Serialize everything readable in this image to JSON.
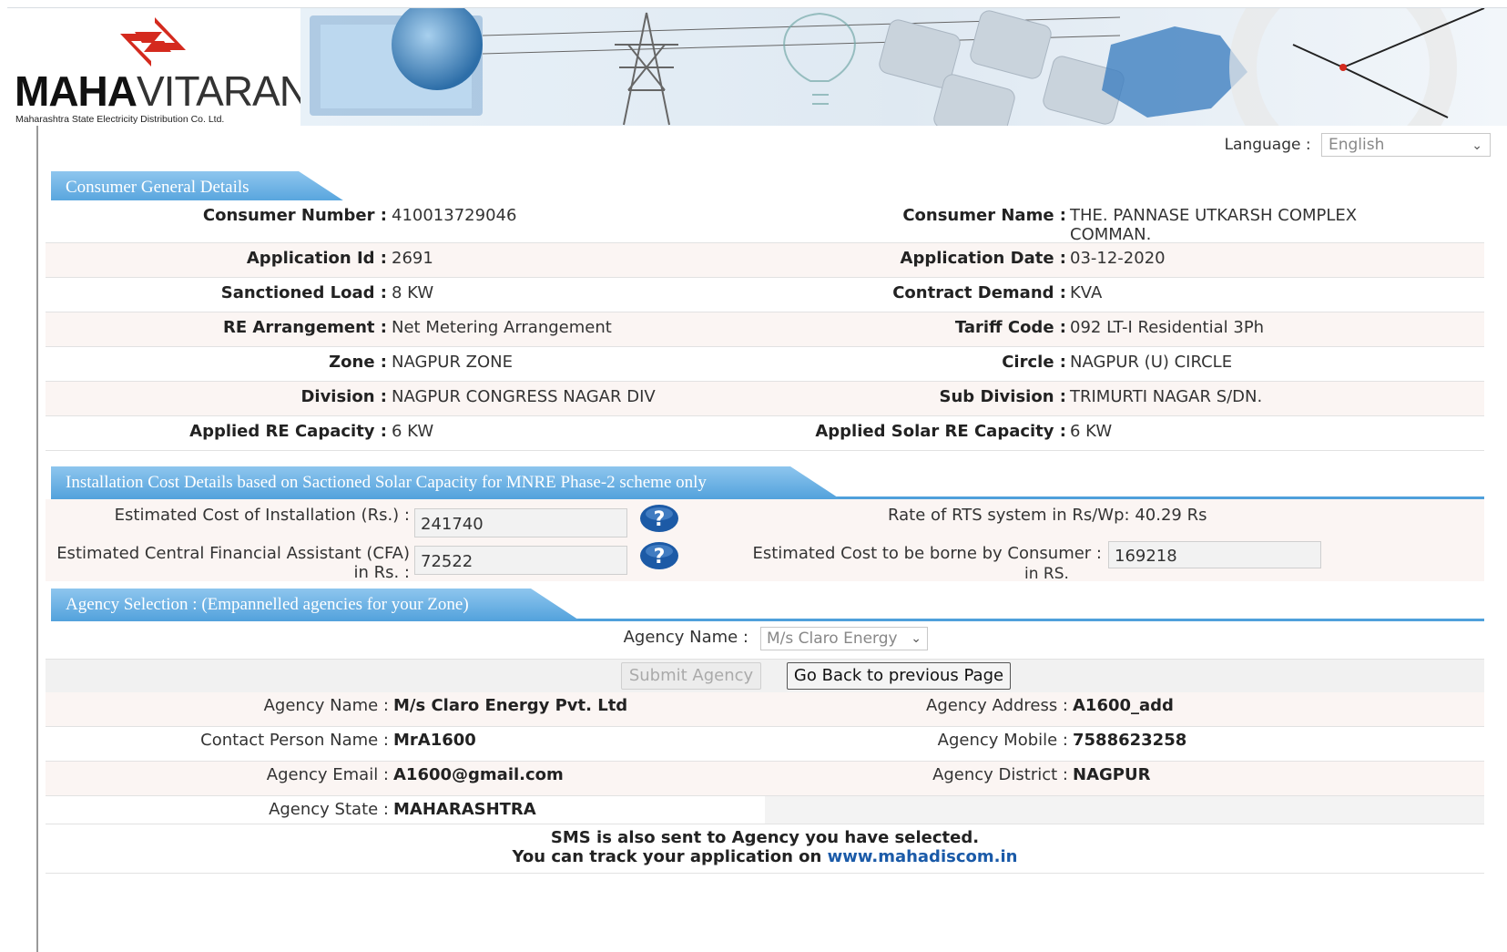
{
  "header": {
    "logo_bold": "MAHA",
    "logo_light": "VITARAN",
    "logo_subtitle": "Maharashtra State Electricity Distribution Co. Ltd."
  },
  "language": {
    "label": "Language :",
    "selected": "English"
  },
  "consumer_section": {
    "title": "Consumer General Details",
    "rows": [
      {
        "l_label": "Consumer Number :",
        "l_value": "410013729046",
        "r_label": "Consumer Name :",
        "r_value": "THE. PANNASE UTKARSH COMPLEX COMMAN."
      },
      {
        "l_label": "Application Id :",
        "l_value": "2691",
        "r_label": "Application Date :",
        "r_value": "03-12-2020"
      },
      {
        "l_label": "Sanctioned Load :",
        "l_value": "8 KW",
        "r_label": "Contract Demand :",
        "r_value": "KVA"
      },
      {
        "l_label": "RE Arrangement :",
        "l_value": "Net Metering Arrangement",
        "r_label": "Tariff Code :",
        "r_value": "092 LT-I Residential 3Ph"
      },
      {
        "l_label": "Zone :",
        "l_value": "NAGPUR ZONE",
        "r_label": "Circle :",
        "r_value": "NAGPUR (U) CIRCLE"
      },
      {
        "l_label": "Division :",
        "l_value": "NAGPUR CONGRESS NAGAR DIV",
        "r_label": "Sub Division :",
        "r_value": "TRIMURTI NAGAR S/DN."
      },
      {
        "l_label": "Applied RE Capacity :",
        "l_value": "6 KW",
        "r_label": "Applied Solar RE Capacity :",
        "r_value": "6 KW"
      }
    ]
  },
  "cost_section": {
    "title": "Installation Cost Details based on Sactioned Solar Capacity for MNRE Phase-2 scheme only",
    "estimated_cost_label": "Estimated Cost of Installation (Rs.) :",
    "estimated_cost_value": "241740",
    "rate_label": "Rate of RTS system in Rs/Wp:",
    "rate_value": "40.29 Rs",
    "cfa_label_line1": "Estimated Central Financial Assistant (CFA)",
    "cfa_label_line2": "in Rs. :",
    "cfa_value": "72522",
    "consumer_cost_label": "Estimated Cost to be borne by Consumer :",
    "consumer_cost_value": "169218",
    "consumer_cost_suffix": "in RS."
  },
  "agency_section": {
    "title": "Agency Selection : (Empannelled agencies for your Zone)",
    "agency_name_label": "Agency Name :",
    "agency_selected": "M/s Claro Energy",
    "submit_label": "Submit Agency",
    "back_label": "Go Back to previous Page",
    "details": [
      {
        "l_label": "Agency Name :",
        "l_value": "M/s Claro Energy Pvt. Ltd",
        "r_label": "Agency Address :",
        "r_value": "A1600_add"
      },
      {
        "l_label": "Contact Person Name :",
        "l_value": "MrA1600",
        "r_label": "Agency Mobile :",
        "r_value": "7588623258"
      },
      {
        "l_label": "Agency Email :",
        "l_value": "A1600@gmail.com",
        "r_label": "Agency District :",
        "r_value": "NAGPUR"
      },
      {
        "l_label": "Agency State :",
        "l_value": "MAHARASHTRA"
      }
    ],
    "sms_line1": "SMS is also sent to Agency you have selected.",
    "sms_line2": "You can track your application on",
    "site_link": "www.mahadiscom.in"
  },
  "colors": {
    "section_blue": "#4fa0db",
    "logo_red": "#d42a1e",
    "link_blue": "#1a5aa8"
  },
  "icons": [
    "help-icon",
    "chevron-down-icon"
  ]
}
